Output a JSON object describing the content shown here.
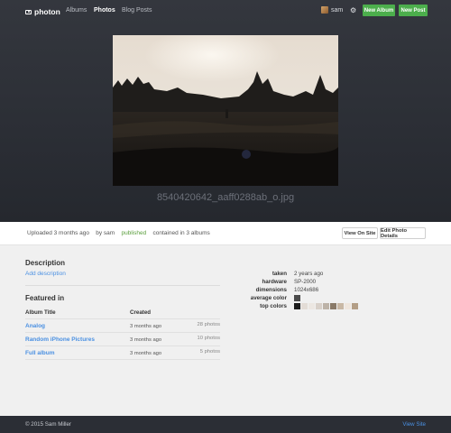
{
  "nav": {
    "brand": "photon",
    "links": [
      "Albums",
      "Photos",
      "Blog Posts"
    ],
    "active": "Photos",
    "user": "sam",
    "new_album": "New Album",
    "new_post": "New Post"
  },
  "photo": {
    "filename": "8540420642_aaff0288ab_o.jpg"
  },
  "info": {
    "uploaded": "Uploaded 3 months ago",
    "by": "by sam",
    "status": "published",
    "contained": "contained in 3 albums",
    "view_on_site": "View On Site",
    "edit_details": "Edit Photo Details"
  },
  "description": {
    "heading": "Description",
    "add": "Add description"
  },
  "featured": {
    "heading": "Featured in",
    "col_title": "Album Title",
    "col_created": "Created",
    "rows": [
      {
        "title": "Analog",
        "created": "3 months ago",
        "count": "28 photos"
      },
      {
        "title": "Random iPhone Pictures",
        "created": "3 months ago",
        "count": "10 photos"
      },
      {
        "title": "Full album",
        "created": "3 months ago",
        "count": "5 photos"
      }
    ]
  },
  "meta": {
    "taken_label": "taken",
    "taken": "2 years ago",
    "hardware_label": "hardware",
    "hardware": "SP-2000",
    "dimensions_label": "dimensions",
    "dimensions": "1024x686",
    "avg_color_label": "average color",
    "avg_color": "#4a4a4a",
    "top_colors_label": "top colors",
    "top_colors": [
      "#1c1c1c",
      "#e3dcd6",
      "#ece7e2",
      "#d8d0c9",
      "#bdb3a8",
      "#8a7a68",
      "#c9b8a5",
      "#efe6dd",
      "#b39e86"
    ]
  },
  "footer": {
    "copyright": "© 2015 Sam Miller",
    "view_site": "View Site"
  },
  "colors": {
    "accent_green": "#4cae4c",
    "link_blue": "#4a90e2",
    "published_green": "#5a9e3c"
  }
}
